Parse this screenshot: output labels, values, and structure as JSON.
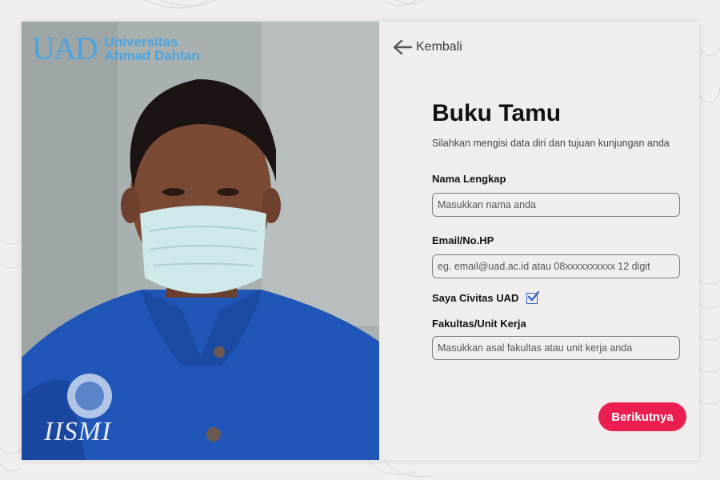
{
  "logo": {
    "mark": "UAD",
    "line1": "Universitas",
    "line2": "Ahmad Dahlan"
  },
  "shirt_badge": "IISMI",
  "nav": {
    "back_label": "Kembali"
  },
  "form": {
    "title": "Buku Tamu",
    "subtitle": "Silahkan mengisi data diri dan tujuan kunjungan anda",
    "name_label": "Nama Lengkap",
    "name_placeholder": "Masukkan nama anda",
    "name_value": "",
    "contact_label": "Email/No.HP",
    "contact_placeholder": "eg. email@uad.ac.id atau 08xxxxxxxxxx 12 digit",
    "contact_value": "",
    "civitas_label": "Saya Civitas UAD",
    "civitas_checked": true,
    "unit_label": "Fakultas/Unit Kerja",
    "unit_placeholder": "Masukkan asal fakultas atau unit kerja anda",
    "unit_value": "",
    "next_label": "Berikutnya"
  },
  "colors": {
    "accent": "#ea1f4f",
    "logo_blue": "#4aa3df",
    "checkbox_blue": "#3b63c8"
  }
}
